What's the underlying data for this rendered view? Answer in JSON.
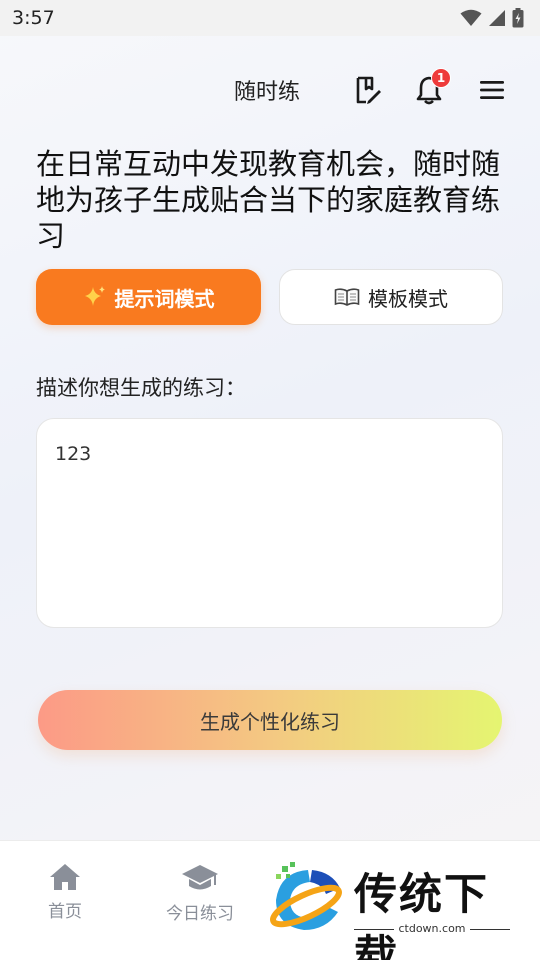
{
  "status_bar": {
    "time": "3:57"
  },
  "header": {
    "title": "随时练",
    "notification_count": "1"
  },
  "headline": "在日常互动中发现教育机会，随时随地为孩子生成贴合当下的家庭教育练习",
  "modes": {
    "prompt_label": "提示词模式",
    "template_label": "模板模式",
    "active": "prompt"
  },
  "form": {
    "label": "描述你想生成的练习：",
    "value": "123"
  },
  "generate_button": "生成个性化练习",
  "bottom_nav": {
    "home": "首页",
    "today": "今日练习"
  },
  "watermark": {
    "text": "传统下载",
    "url": "ctdown.com"
  },
  "colors": {
    "accent": "#f97a1f",
    "badge": "#ee3b3b"
  }
}
